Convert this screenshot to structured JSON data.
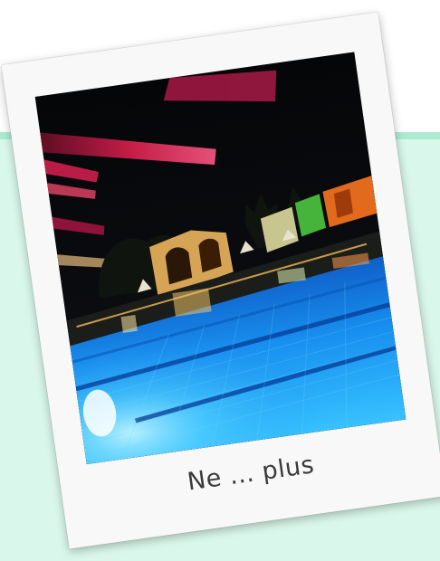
{
  "polaroid": {
    "caption": "Ne ... plus"
  }
}
